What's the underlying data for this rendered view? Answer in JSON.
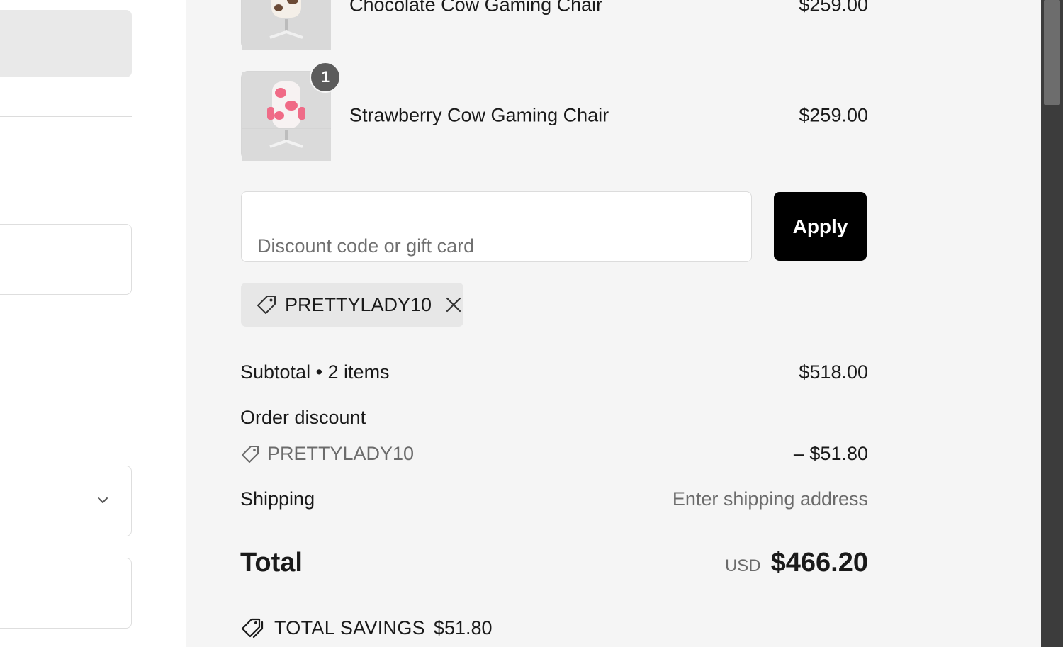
{
  "left": {
    "select_icon": "chevron-down-icon"
  },
  "cart": {
    "items": [
      {
        "name": "Chocolate Cow Gaming Chair",
        "price": "$259.00",
        "quantity": ""
      },
      {
        "name": "Strawberry Cow Gaming Chair",
        "price": "$259.00",
        "quantity": "1"
      }
    ]
  },
  "discount": {
    "placeholder": "Discount code or gift card",
    "apply_label": "Apply",
    "applied_code": "PRETTYLADY10"
  },
  "summary": {
    "subtotal_label": "Subtotal • 2 items",
    "subtotal_value": "$518.00",
    "order_discount_label": "Order discount",
    "discount_code": "PRETTYLADY10",
    "discount_value": "– $51.80",
    "shipping_label": "Shipping",
    "shipping_value": "Enter shipping address",
    "total_label": "Total",
    "currency": "USD",
    "total_value": "$466.20",
    "savings_label": "TOTAL SAVINGS",
    "savings_value": "$51.80"
  },
  "colors": {
    "summary_bg": "#f5f5f5",
    "apply_button_bg": "#000000",
    "chip_bg": "#e7e7e7",
    "badge_bg": "#5c5c5c",
    "muted_text": "#6b6b6b"
  }
}
